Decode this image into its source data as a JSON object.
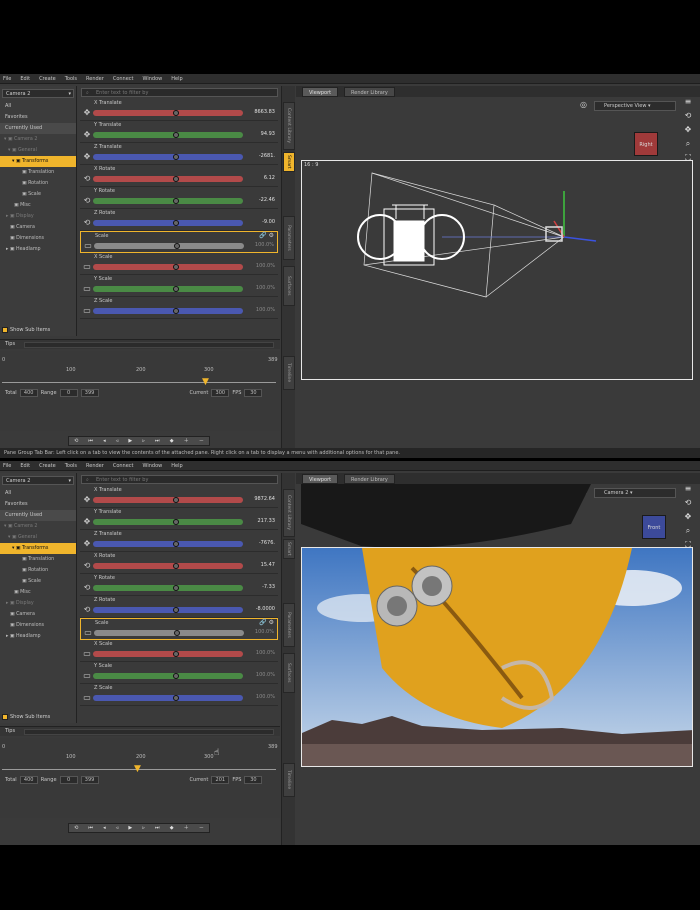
{
  "menu": [
    "File",
    "Edit",
    "Create",
    "Tools",
    "Render",
    "Connect",
    "Window",
    "Help"
  ],
  "top": {
    "camera": "Camera 2",
    "left_list": [
      "All",
      "Favorites",
      "Currently Used"
    ],
    "tree": [
      "Camera 2",
      "General",
      "Transforms",
      "Translation",
      "Rotation",
      "Scale",
      "Misc",
      "Display",
      "Camera",
      "Dimensions",
      "Headlamp"
    ],
    "show_sub": "Show Sub Items",
    "filter_placeholder": "Enter text to filter by",
    "params": [
      {
        "label": "X Translate",
        "value": "8663.83",
        "color": "#b24a4a",
        "dim": false
      },
      {
        "label": "Y Translate",
        "value": "94.93",
        "color": "#4a8a45",
        "dim": false
      },
      {
        "label": "Z Translate",
        "value": "-2681.",
        "color": "#4a58b0",
        "dim": false
      },
      {
        "label": "X Rotate",
        "value": "6.12",
        "color": "#b24a4a",
        "dim": false
      },
      {
        "label": "Y Rotate",
        "value": "-22.46",
        "color": "#4a8a45",
        "dim": false
      },
      {
        "label": "Z Rotate",
        "value": "-9.00",
        "color": "#4a58b0",
        "dim": false
      },
      {
        "label": "Scale",
        "value": "100.0%",
        "color": "#8a8a8a",
        "dim": true
      },
      {
        "label": "X Scale",
        "value": "100.0%",
        "color": "#b24a4a",
        "dim": true
      },
      {
        "label": "Y Scale",
        "value": "100.0%",
        "color": "#4a8a45",
        "dim": true
      },
      {
        "label": "Z Scale",
        "value": "100.0%",
        "color": "#4a58b0",
        "dim": true
      }
    ],
    "tips": "Tips",
    "timeline": {
      "ticks": [
        "0",
        "100",
        "200",
        "300",
        "389"
      ],
      "total_label": "Total",
      "total": "400",
      "range_label": "Range",
      "range_start": "0",
      "range_end": "399",
      "current_label": "Current",
      "current": "300",
      "fps_label": "FPS",
      "fps": "30"
    },
    "view_tabs": [
      "Viewport",
      "Render Library"
    ],
    "view_camera": "Perspective View",
    "cube_label": "Right",
    "vp_label": "16 : 9",
    "side_tabs": [
      "Content Library",
      "Smart",
      "Parameters",
      "Surfaces",
      "Timeline"
    ],
    "status": "Pane Group Tab Bar: Left click on a tab to view the contents of the attached pane. Right click on a tab to display a menu with additional options for that pane."
  },
  "bottom": {
    "camera": "Camera 2",
    "left_list": [
      "All",
      "Favorites",
      "Currently Used"
    ],
    "tree": [
      "Camera 2",
      "General",
      "Transforms",
      "Translation",
      "Rotation",
      "Scale",
      "Misc",
      "Display",
      "Camera",
      "Dimensions",
      "Headlamp"
    ],
    "show_sub": "Show Sub Items",
    "filter_placeholder": "Enter text to filter by",
    "params": [
      {
        "label": "X Translate",
        "value": "9872.64",
        "color": "#b24a4a",
        "dim": false
      },
      {
        "label": "Y Translate",
        "value": "217.33",
        "color": "#4a8a45",
        "dim": false
      },
      {
        "label": "Z Translate",
        "value": "-7676.",
        "color": "#4a58b0",
        "dim": false
      },
      {
        "label": "X Rotate",
        "value": "15.47",
        "color": "#b24a4a",
        "dim": false
      },
      {
        "label": "Y Rotate",
        "value": "-7.33",
        "color": "#4a8a45",
        "dim": false
      },
      {
        "label": "Z Rotate",
        "value": "-8.0000",
        "color": "#4a58b0",
        "dim": false
      },
      {
        "label": "Scale",
        "value": "100.0%",
        "color": "#8a8a8a",
        "dim": true
      },
      {
        "label": "X Scale",
        "value": "100.0%",
        "color": "#b24a4a",
        "dim": true
      },
      {
        "label": "Y Scale",
        "value": "100.0%",
        "color": "#4a8a45",
        "dim": true
      },
      {
        "label": "Z Scale",
        "value": "100.0%",
        "color": "#4a58b0",
        "dim": true
      }
    ],
    "tips": "Tips",
    "timeline": {
      "ticks": [
        "0",
        "100",
        "200",
        "300",
        "389"
      ],
      "total_label": "Total",
      "total": "400",
      "range_label": "Range",
      "range_start": "0",
      "range_end": "399",
      "current_label": "Current",
      "current": "201",
      "fps_label": "FPS",
      "fps": "30"
    },
    "view_tabs": [
      "Viewport",
      "Render Library"
    ],
    "view_camera": "Camera 2",
    "cube_label": "Front",
    "side_tabs": [
      "Content Library",
      "Smart",
      "Parameters",
      "Surfaces",
      "Timeline"
    ]
  },
  "colors": {
    "accent": "#f0b52c",
    "panel": "#3a3a3a",
    "frame": "#e8e8e8"
  }
}
